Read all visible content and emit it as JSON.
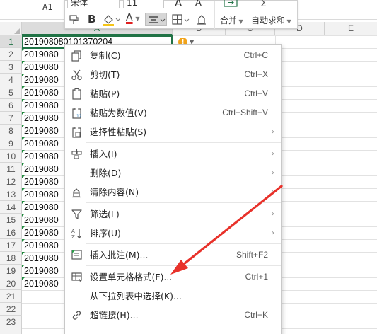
{
  "name_box": "A1",
  "columns": [
    "A",
    "B",
    "C",
    "D",
    "E"
  ],
  "rows": [
    "1",
    "2",
    "3",
    "4",
    "5",
    "6",
    "7",
    "8",
    "9",
    "10",
    "11",
    "12",
    "13",
    "14",
    "15",
    "16",
    "17",
    "18",
    "19",
    "20",
    "21",
    "22",
    "23"
  ],
  "selected_column": "A",
  "selected_row": "1",
  "cells_col_a": [
    "201908080101370204",
    "2019080",
    "2019080",
    "2019080",
    "2019080",
    "2019080",
    "2019080",
    "2019080",
    "2019080",
    "2019080",
    "2019080",
    "2019080",
    "2019080",
    "2019080",
    "2019080",
    "2019080",
    "2019080",
    "2019080",
    "2019080",
    "2019080"
  ],
  "mini_toolbar": {
    "font_name": "宋体",
    "font_size": "11",
    "bold_label": "B",
    "font_color_label": "A",
    "merge_label": "合并",
    "autosum_label": "自动求和",
    "grow_font_label": "A",
    "shrink_font_label": "A",
    "colors": {
      "font_color": "#e02020",
      "fill_color": "#f5c518"
    }
  },
  "context_menu": {
    "items": [
      {
        "label": "复制(C)",
        "shortcut": "Ctrl+C",
        "icon": "copy-icon"
      },
      {
        "label": "剪切(T)",
        "shortcut": "Ctrl+X",
        "icon": "scissors-icon"
      },
      {
        "label": "粘贴(P)",
        "shortcut": "Ctrl+V",
        "icon": "paste-icon"
      },
      {
        "label": "粘贴为数值(V)",
        "shortcut": "Ctrl+Shift+V",
        "icon": "paste-values-icon"
      },
      {
        "label": "选择性粘贴(S)",
        "shortcut": "",
        "icon": "paste-special-icon",
        "submenu": true
      },
      {
        "label": "插入(I)",
        "shortcut": "",
        "icon": "insert-icon",
        "submenu": true
      },
      {
        "label": "删除(D)",
        "shortcut": "",
        "icon": "",
        "submenu": true
      },
      {
        "label": "清除内容(N)",
        "shortcut": "",
        "icon": "eraser-icon",
        "submenu": true
      },
      {
        "label": "筛选(L)",
        "shortcut": "",
        "icon": "filter-icon",
        "submenu": true
      },
      {
        "label": "排序(U)",
        "shortcut": "",
        "icon": "sort-icon",
        "submenu": true
      },
      {
        "label": "插入批注(M)...",
        "shortcut": "Shift+F2",
        "icon": "comment-icon"
      },
      {
        "label": "设置单元格格式(F)...",
        "shortcut": "Ctrl+1",
        "icon": "format-cells-icon"
      },
      {
        "label": "从下拉列表中选择(K)...",
        "shortcut": "",
        "icon": ""
      },
      {
        "label": "超链接(H)...",
        "shortcut": "Ctrl+K",
        "icon": "link-icon"
      }
    ]
  },
  "annotation": {
    "arrow_color": "#e8312a"
  }
}
